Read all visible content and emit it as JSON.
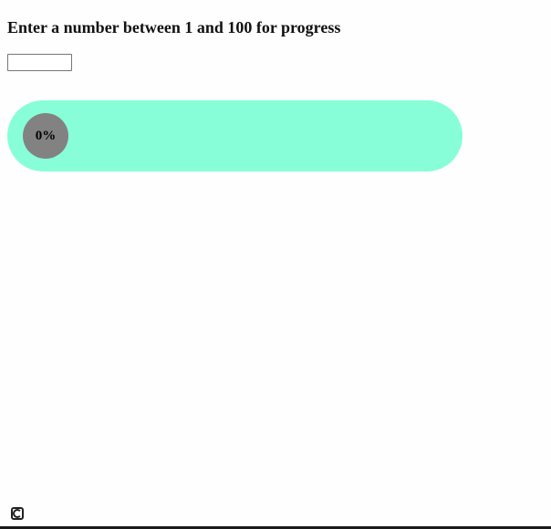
{
  "heading": {
    "text": "Enter a number between 1 and 100 for progress"
  },
  "number_input": {
    "value": "",
    "placeholder": ""
  },
  "progress": {
    "label": "0%",
    "percent": 0,
    "track_color": "#88fed8",
    "knob_color": "#828282"
  },
  "footer": {
    "icon": "screen-capture-icon"
  }
}
